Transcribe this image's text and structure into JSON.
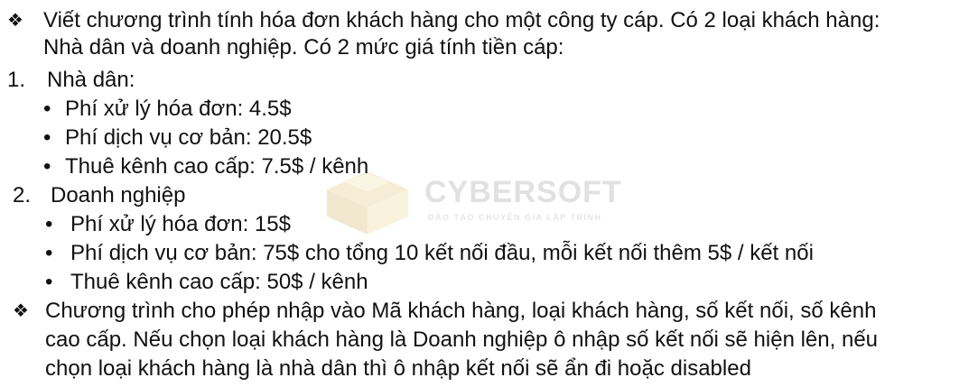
{
  "watermark": {
    "name": "CYBERSOFT",
    "tagline": "ĐÀO TẠO CHUYÊN GIA LẬP TRÌNH"
  },
  "markers": {
    "diamond": "❖",
    "bullet": "•",
    "n1": "1.",
    "n2": "2."
  },
  "intro": {
    "line1": "Viết chương trình tính hóa đơn khách hàng cho một công ty cáp. Có 2 loại khách hàng:",
    "line2": "Nhà dân và doanh nghiệp. Có 2 mức giá tính tiền cáp:"
  },
  "residential": {
    "heading": "Nhà dân:",
    "items": [
      "Phí xử lý hóa đơn: 4.5$",
      "Phí dịch vụ cơ bản: 20.5$",
      "Thuê kênh cao cấp: 7.5$ / kênh"
    ]
  },
  "business": {
    "heading": "Doanh nghiệp",
    "items": [
      "Phí xử lý hóa đơn: 15$",
      "Phí dịch vụ cơ bản: 75$ cho tổng 10 kết nối đầu, mỗi kết nối thêm 5$ / kết nối",
      "Thuê kênh cao cấp: 50$ / kênh"
    ]
  },
  "program": {
    "line1": "Chương trình cho phép nhập vào Mã khách hàng, loại khách hàng, số kết nối, số kênh",
    "line2": "cao cấp. Nếu chọn loại khách hàng là Doanh nghiệp ô nhập số kết nối sẽ hiện lên, nếu",
    "line3": "chọn loại khách hàng là nhà dân thì ô nhập kết nối sẽ ẩn đi hoặc disabled"
  }
}
